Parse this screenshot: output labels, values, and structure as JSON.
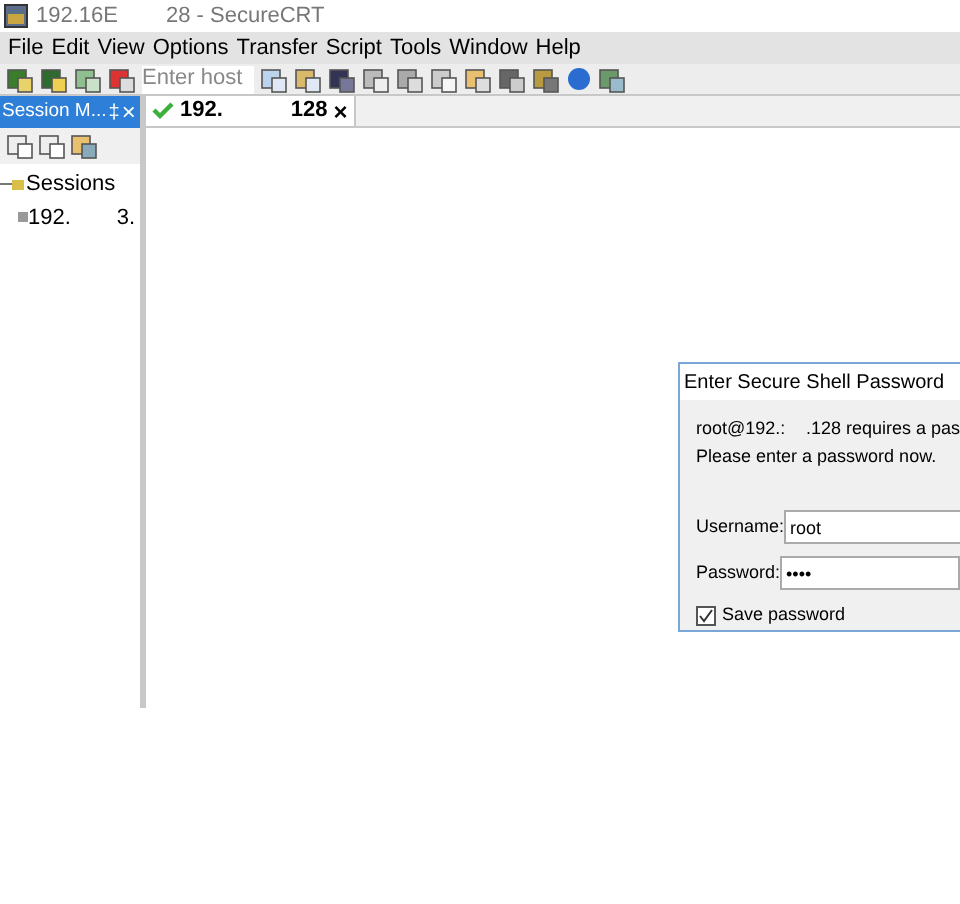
{
  "window": {
    "title_parts": [
      "192.16E",
      "28 - SecureCRT"
    ]
  },
  "menu": [
    "File",
    "Edit",
    "View",
    "Options",
    "Transfer",
    "Script",
    "Tools",
    "Window",
    "Help"
  ],
  "toolbar": {
    "host_field": {
      "placeholder": "Enter host"
    }
  },
  "session_manager": {
    "title": "Session M...",
    "pin": "‡",
    "close": "×",
    "tree": [
      {
        "label": "Sessions",
        "expanded": true,
        "children": [
          {
            "label_parts": [
              "192.",
              "3."
            ]
          }
        ]
      }
    ]
  },
  "tabs": [
    {
      "label_parts": [
        "192.",
        "128"
      ],
      "close": "×",
      "selected": true
    }
  ],
  "dialog": {
    "title": "Enter Secure Shell Password",
    "message_parts": [
      "root@192.:",
      ".128 requires a pas"
    ],
    "message_line2": "Please enter a password now.",
    "username_label": "Username:",
    "username": "root",
    "password_label": "Password:",
    "password": "••••",
    "save_label": "Save password",
    "save_checked": true
  }
}
